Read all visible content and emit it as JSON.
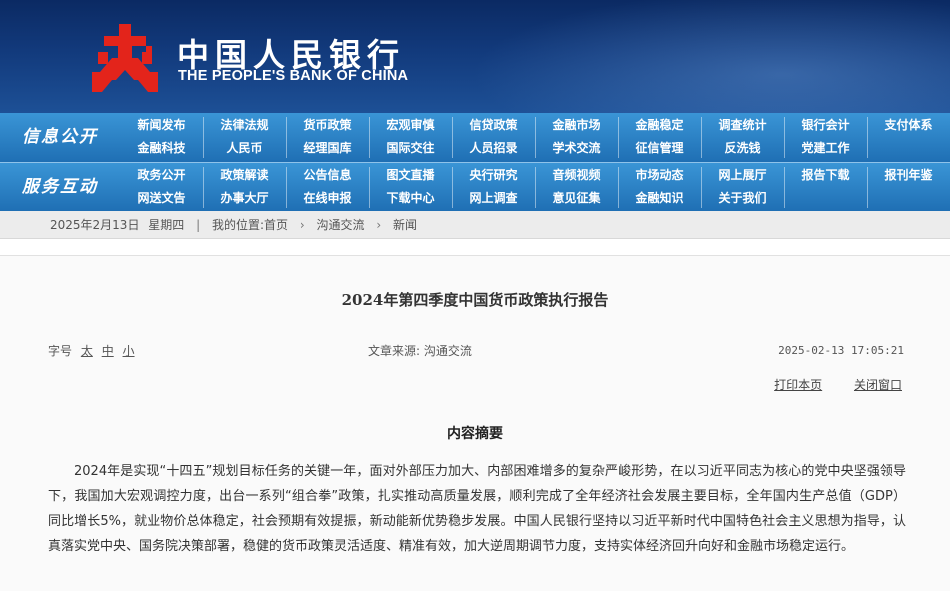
{
  "header": {
    "bank_name_cn": "中国人民银行",
    "bank_name_en": "THE PEOPLE'S BANK OF CHINA",
    "logo_icon": "pboc-logo-icon",
    "colors": {
      "banner": "#123a7c",
      "nav": "#2a7fc4",
      "logo": "#e02020"
    }
  },
  "nav": {
    "info_label": "信息公开",
    "service_label": "服务互动",
    "row1_top": [
      "新闻发布",
      "法律法规",
      "货币政策",
      "宏观审慎",
      "信贷政策",
      "金融市场",
      "金融稳定",
      "调查统计",
      "银行会计",
      "支付体系"
    ],
    "row1_sub": [
      "金融科技",
      "人民币",
      "经理国库",
      "国际交往",
      "人员招录",
      "学术交流",
      "征信管理",
      "反洗钱",
      "党建工作",
      ""
    ],
    "row2_top": [
      "政务公开",
      "政策解读",
      "公告信息",
      "图文直播",
      "央行研究",
      "音频视频",
      "市场动态",
      "网上展厅",
      "报告下载",
      "报刊年鉴"
    ],
    "row2_sub": [
      "网送文告",
      "办事大厅",
      "在线申报",
      "下载中心",
      "网上调查",
      "意见征集",
      "金融知识",
      "关于我们",
      "",
      ""
    ]
  },
  "breadcrumb": {
    "date": "2025年2月13日",
    "weekday": "星期四",
    "location_label": "我的位置:",
    "items": [
      "首页",
      "沟通交流",
      "新闻"
    ]
  },
  "article": {
    "title": "2024年第四季度中国货币政策执行报告",
    "font_label": "字号",
    "sizes": [
      "太",
      "中",
      "小"
    ],
    "source": "文章来源: 沟通交流",
    "timestamp": "2025-02-13 17:05:21",
    "print_label": "打印本页",
    "close_label": "关闭窗口",
    "abstract_heading": "内容摘要",
    "abstract_text": "2024年是实现“十四五”规划目标任务的关键一年，面对外部压力加大、内部困难增多的复杂严峻形势，在以习近平同志为核心的党中央坚强领导下，我国加大宏观调控力度，出台一系列“组合拳”政策，扎实推动高质量发展，顺利完成了全年经济社会发展主要目标，全年国内生产总值（GDP）同比增长5%，就业物价总体稳定，社会预期有效提振，新动能新优势稳步发展。中国人民银行坚持以习近平新时代中国特色社会主义思想为指导，认真落实党中央、国务院决策部署，稳健的货币政策灵活适度、精准有效，加大逆周期调节力度，支持实体经济回升向好和金融市场稳定运行。"
  }
}
